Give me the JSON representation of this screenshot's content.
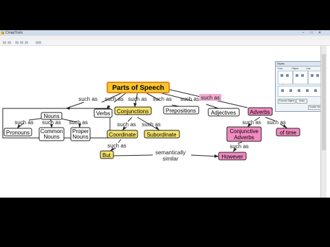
{
  "window": {
    "title": "CmapTools"
  },
  "menu": [
    "File",
    "Edit",
    "Format",
    "Collaborate",
    "Tools",
    "Window",
    "Help"
  ],
  "map": {
    "nodes": {
      "parts": "Parts of Speech",
      "nouns": "Nouns",
      "verbs": "Verbs",
      "conjunctions": "Conjunctions",
      "prepositions": "Prepositions",
      "adjectives": "Adjectives",
      "adverbs": "Adverbs",
      "pronouns": "Pronouns",
      "common": [
        "Common",
        "Nouns"
      ],
      "proper": [
        "Proper",
        "Nouns"
      ],
      "coordinate": "Coordinate",
      "subordinate": "Subordinate",
      "conjunctive": [
        "Conjunctive",
        "Adverbs"
      ],
      "oftime": "of time",
      "but": "But",
      "however": "However"
    },
    "links": {
      "such_as": "such as",
      "semantically": [
        "semantically",
        "similar"
      ]
    }
  },
  "styles_panel": {
    "title": "Styles",
    "sections": [
      "Font",
      "Object",
      "Line",
      "CMap"
    ],
    "buttons": [
      "Format Object",
      "Undo",
      "Create New"
    ]
  },
  "colors": {
    "yellow": "#f7e46b",
    "orange_border": "#e08a1e",
    "pink": "#f28bc0",
    "pink_highlight": "#f5a9d0",
    "dark_border": "#333333"
  }
}
